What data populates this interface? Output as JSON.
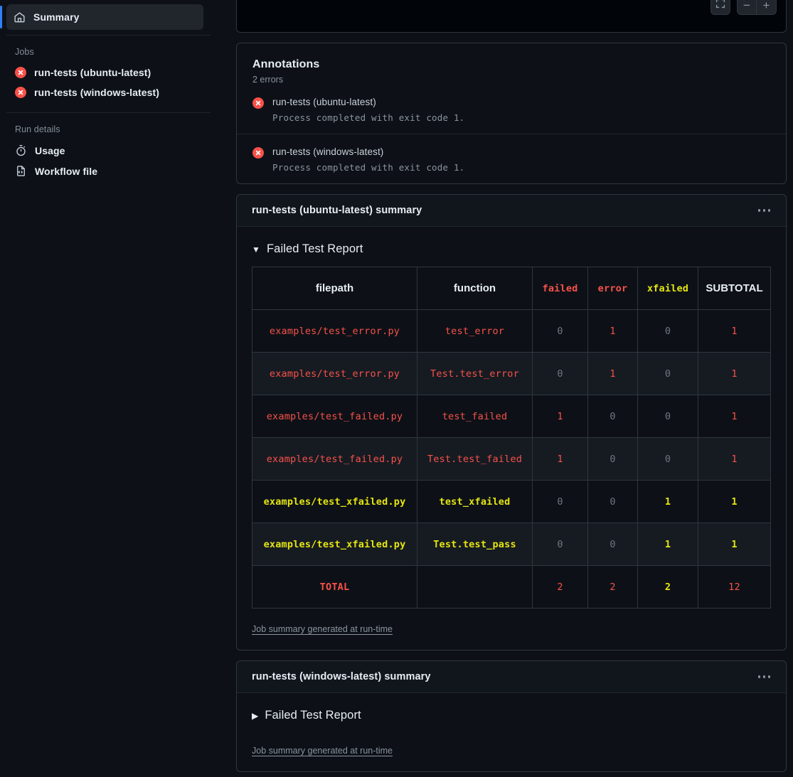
{
  "sidebar": {
    "summary": {
      "label": "Summary",
      "icon": "home-icon",
      "active": true
    },
    "jobs_title": "Jobs",
    "jobs": [
      {
        "label": "run-tests (ubuntu-latest)",
        "status": "failed",
        "icon": "x-circle-fill-icon"
      },
      {
        "label": "run-tests (windows-latest)",
        "status": "failed",
        "icon": "x-circle-fill-icon"
      }
    ],
    "run_details_title": "Run details",
    "run_details": [
      {
        "label": "Usage",
        "icon": "stopwatch-icon"
      },
      {
        "label": "Workflow file",
        "icon": "file-code-icon"
      }
    ]
  },
  "toolbar": {
    "fullscreen_icon": "fullscreen-icon",
    "zoom_out_label": "−",
    "zoom_in_label": "+"
  },
  "annotations": {
    "title": "Annotations",
    "subtitle": "2 errors",
    "items": [
      {
        "name": "run-tests (ubuntu-latest)",
        "message": "Process completed with exit code 1.",
        "icon": "x-circle-fill-icon"
      },
      {
        "name": "run-tests (windows-latest)",
        "message": "Process completed with exit code 1.",
        "icon": "x-circle-fill-icon"
      }
    ]
  },
  "job_summaries": [
    {
      "title": "run-tests (ubuntu-latest) summary",
      "kebab": "more-options-icon",
      "disclosure_label": "Failed Test Report",
      "expanded": true,
      "marker": "▼",
      "footer_link": "Job summary generated at run-time"
    },
    {
      "title": "run-tests (windows-latest) summary",
      "kebab": "more-options-icon",
      "disclosure_label": "Failed Test Report",
      "expanded": false,
      "marker": "▶",
      "footer_link": "Job summary generated at run-time"
    }
  ],
  "chart_data": {
    "type": "table",
    "title": "Failed Test Report",
    "columns": [
      {
        "label": "filepath",
        "style": "sans",
        "color": "#e6edf3"
      },
      {
        "label": "function",
        "style": "sans",
        "color": "#e6edf3"
      },
      {
        "label": "failed",
        "style": "mono",
        "color": "#f85149"
      },
      {
        "label": "error",
        "style": "mono",
        "color": "#f85149"
      },
      {
        "label": "xfailed",
        "style": "mono-b",
        "color": "#e5e510"
      },
      {
        "label": "SUBTOTAL",
        "style": "sans",
        "color": "#e6edf3"
      }
    ],
    "rows": [
      {
        "filepath": "examples/test_error.py",
        "function": "test_error",
        "failed": "0",
        "error": "1",
        "xfailed": "0",
        "subtotal": "1",
        "tone": "red"
      },
      {
        "filepath": "examples/test_error.py",
        "function": "Test.test_error",
        "failed": "0",
        "error": "1",
        "xfailed": "0",
        "subtotal": "1",
        "tone": "red"
      },
      {
        "filepath": "examples/test_failed.py",
        "function": "test_failed",
        "failed": "1",
        "error": "0",
        "xfailed": "0",
        "subtotal": "1",
        "tone": "red"
      },
      {
        "filepath": "examples/test_failed.py",
        "function": "Test.test_failed",
        "failed": "1",
        "error": "0",
        "xfailed": "0",
        "subtotal": "1",
        "tone": "red"
      },
      {
        "filepath": "examples/test_xfailed.py",
        "function": "test_xfailed",
        "failed": "0",
        "error": "0",
        "xfailed": "1",
        "subtotal": "1",
        "tone": "yellow"
      },
      {
        "filepath": "examples/test_xfailed.py",
        "function": "Test.test_pass",
        "failed": "0",
        "error": "0",
        "xfailed": "1",
        "subtotal": "1",
        "tone": "yellow"
      }
    ],
    "total_row": {
      "filepath": "TOTAL",
      "function": "",
      "failed": "2",
      "error": "2",
      "xfailed": "2",
      "subtotal": "12"
    }
  },
  "colors": {
    "accent": "#2f81f7",
    "error": "#f85149",
    "warning": "#e5e510",
    "dim": "#6e7681",
    "background": "#0d1117",
    "border": "#30363d"
  }
}
